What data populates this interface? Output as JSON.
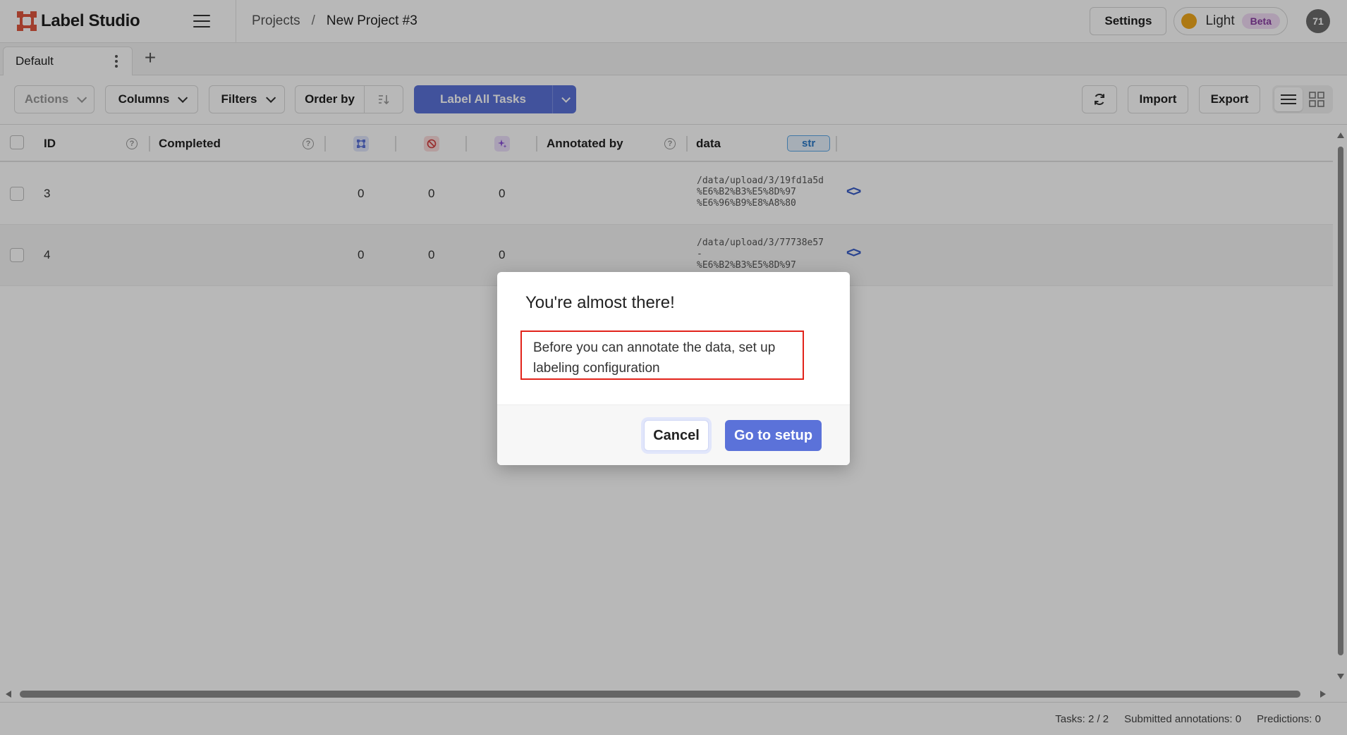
{
  "header": {
    "app_name": "Label Studio",
    "breadcrumb_projects": "Projects",
    "breadcrumb_separator": "/",
    "breadcrumb_current": "New Project #3",
    "settings_label": "Settings",
    "theme_label": "Light",
    "beta_label": "Beta",
    "avatar_initials": "71",
    "brand_color": "#e0573f"
  },
  "tabs": {
    "items": [
      {
        "label": "Default",
        "active": true
      }
    ],
    "add_label": "+"
  },
  "toolbar": {
    "actions_label": "Actions",
    "columns_label": "Columns",
    "filters_label": "Filters",
    "order_by_label": "Order by",
    "label_all_label": "Label All Tasks",
    "import_label": "Import",
    "export_label": "Export",
    "accent_color": "#5b72d9"
  },
  "table": {
    "headers": {
      "id": "ID",
      "completed": "Completed",
      "annotated_by": "Annotated by",
      "data": "data",
      "data_type": "str"
    },
    "rows": [
      {
        "id": "3",
        "total": "0",
        "cancelled": "0",
        "predictions": "0",
        "path": [
          "/data/upload/3/19fd1a5d-",
          "%E6%B2%B3%E5%8D%97",
          "%E6%96%B9%E8%A8%80"
        ]
      },
      {
        "id": "4",
        "total": "0",
        "cancelled": "0",
        "predictions": "0",
        "path": [
          "/data/upload/3/77738e57",
          "-",
          "%E6%B2%B3%E5%8D%97"
        ]
      }
    ]
  },
  "footer": {
    "tasks": "Tasks: 2 / 2",
    "submitted": "Submitted annotations: 0",
    "predictions": "Predictions: 0"
  },
  "modal": {
    "title": "You're almost there!",
    "body": "Before you can annotate the data, set up labeling configuration",
    "cancel_label": "Cancel",
    "confirm_label": "Go to setup"
  }
}
